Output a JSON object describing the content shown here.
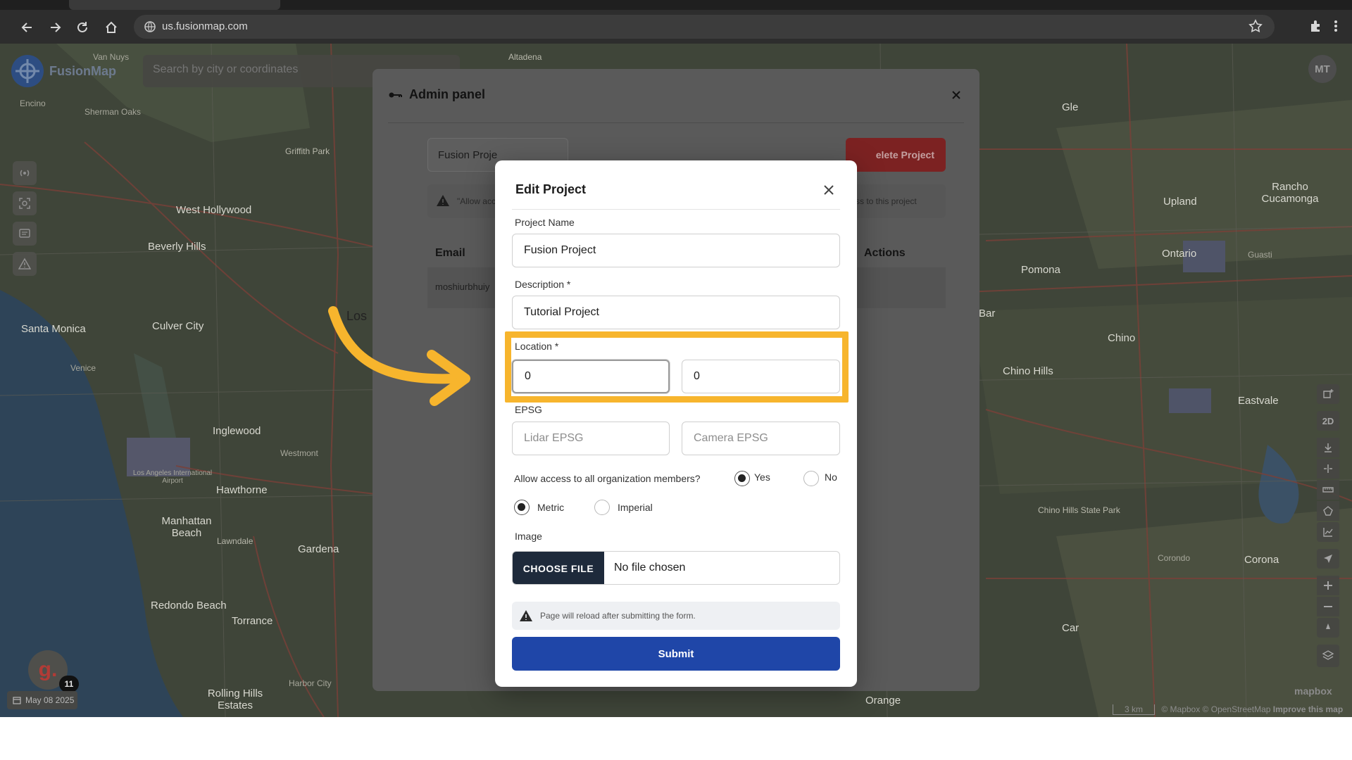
{
  "browser": {
    "url": "us.fusionmap.com"
  },
  "app": {
    "brand": "FusionMap",
    "search_placeholder": "Search by city or coordinates",
    "avatar_initials": "MT",
    "date": "May 08 2025",
    "badge_letter": "g.",
    "badge_count": "11",
    "view_mode": "2D",
    "attribution": "© Mapbox © OpenStreetMap",
    "improve": "Improve this map",
    "scale": "3 km",
    "mapbox_logo": "mapbox"
  },
  "map_labels": [
    "Van Nuys",
    "Altadena",
    "Encino",
    "Sherman Oaks",
    "Griffith Park",
    "West Hollywood",
    "Beverly Hills",
    "Santa Monica",
    "Culver City",
    "Venice",
    "Inglewood",
    "Westmont",
    "Hawthorne",
    "Manhattan Beach",
    "Lawndale",
    "Gardena",
    "Redondo Beach",
    "Torrance",
    "Rolling Hills Estates",
    "Harbor City",
    "Orange",
    "Upland",
    "Rancho Cucamonga",
    "Ontario",
    "Pomona",
    "Chino",
    "Chino Hills",
    "Eastvale",
    "Corona",
    "Chino Hills State Park",
    "Guasti",
    "Bar",
    "Los Angeles International Airport",
    "Corondo",
    "Los",
    "Gle",
    "Car"
  ],
  "admin_panel": {
    "title": "Admin panel",
    "project_select": "Fusion Proje",
    "delete_button": "elete Project",
    "note_left": "\"Allow acc",
    "note_right": "ss to this project",
    "col_email": "Email",
    "col_actions": "Actions",
    "row_email": "moshiurbhuiy"
  },
  "modal": {
    "title": "Edit Project",
    "project_name_label": "Project Name",
    "project_name_value": "Fusion Project",
    "description_label": "Description *",
    "description_value": "Tutorial Project",
    "location_label": "Location *",
    "location_lat": "0",
    "location_lng": "0",
    "epsg_label": "EPSG",
    "lidar_placeholder": "Lidar EPSG",
    "camera_placeholder": "Camera EPSG",
    "access_question": "Allow access to all organization members?",
    "access_yes": "Yes",
    "access_no": "No",
    "access_selected": "Yes",
    "unit_metric": "Metric",
    "unit_imperial": "Imperial",
    "unit_selected": "Metric",
    "image_label": "Image",
    "choose_file": "CHOOSE FILE",
    "no_file": "No file chosen",
    "alert_text": "Page will reload after submitting the form.",
    "submit": "Submit"
  },
  "colors": {
    "highlight": "#f7b52d",
    "submit": "#1f46a8",
    "delete": "#7c2222",
    "file_button": "#1e2a3b"
  }
}
